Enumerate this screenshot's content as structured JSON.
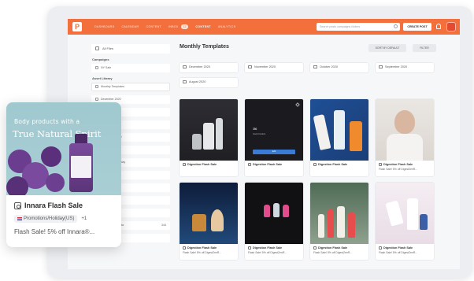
{
  "nav": {
    "links": [
      "DASHBOARD",
      "CALENDAR",
      "CONTENT",
      "INBOX",
      "CONTENT",
      "ANALYTICS"
    ],
    "inbox_badge": "12",
    "search_placeholder": "Search posts campaigns folders",
    "create_label": "CREATE POST"
  },
  "sidebar": {
    "all_files": "All Files",
    "campaigns_heading": "Campaigns",
    "campaign_item": "NY Sale",
    "asset_library_heading": "Asset Library",
    "items": [
      {
        "label": "Monthly Templates",
        "count": ""
      },
      {
        "label": "December 2020",
        "count": ""
      },
      {
        "label": "November 2020",
        "count": ""
      },
      {
        "label": "October 2020",
        "count": ""
      },
      {
        "label": "September 2020",
        "count": ""
      },
      {
        "label": "August 2020",
        "count": ""
      },
      {
        "label": "Promotions/Holiday",
        "count": ""
      },
      {
        "label": "Giveaway Kits",
        "count": ""
      },
      {
        "label": "",
        "count": ""
      },
      {
        "label": "",
        "count": ""
      },
      {
        "label": "",
        "count": ""
      },
      {
        "label": "da FEIRA Canada",
        "count": "344"
      },
      {
        "label": "",
        "count": ""
      }
    ]
  },
  "main": {
    "title": "Monthly Templates",
    "sort_label": "SORT BY DEFAULT",
    "filter_label": "FILTER",
    "folders": [
      "December 2020",
      "November 2020",
      "October 2020",
      "September 2020",
      "August 2020"
    ],
    "cards": [
      {
        "title": "Digestion Flash Sale",
        "sub": ""
      },
      {
        "title": "Digestion Flash Sale",
        "sub": ""
      },
      {
        "title": "Digestion Flash Sale",
        "sub": ""
      },
      {
        "title": "Digestion Flash Sale",
        "sub": "Flash Sale! 5% off DigestZenR..."
      },
      {
        "title": "Digestion Flash Sale",
        "sub": "Flash Sale! 5% off DigestZenR..."
      },
      {
        "title": "Digestion Flash Sale",
        "sub": "Flash Sale! 5% off DigestZenR..."
      },
      {
        "title": "Digestion Flash Sale",
        "sub": "Flash Sale! 5% off DigestZenR..."
      },
      {
        "title": "Digestion Flash Sale",
        "sub": "Flash Sale! 5% off DigestZenR..."
      }
    ],
    "post_preview": {
      "number": "356",
      "small": "Good Content",
      "button": "Edit"
    }
  },
  "float_card": {
    "image_subtitle": "Body products with a",
    "image_headline": "True Natural Spirit",
    "title": "Innara Flash Sale",
    "tag": "Promotions/Holiday(US)",
    "extra_count": "+1",
    "caption": "Flash Sale! 5% off Innara®..."
  },
  "colors": {
    "brand": "#f36f3c",
    "accent_blue": "#3a7bd5"
  }
}
